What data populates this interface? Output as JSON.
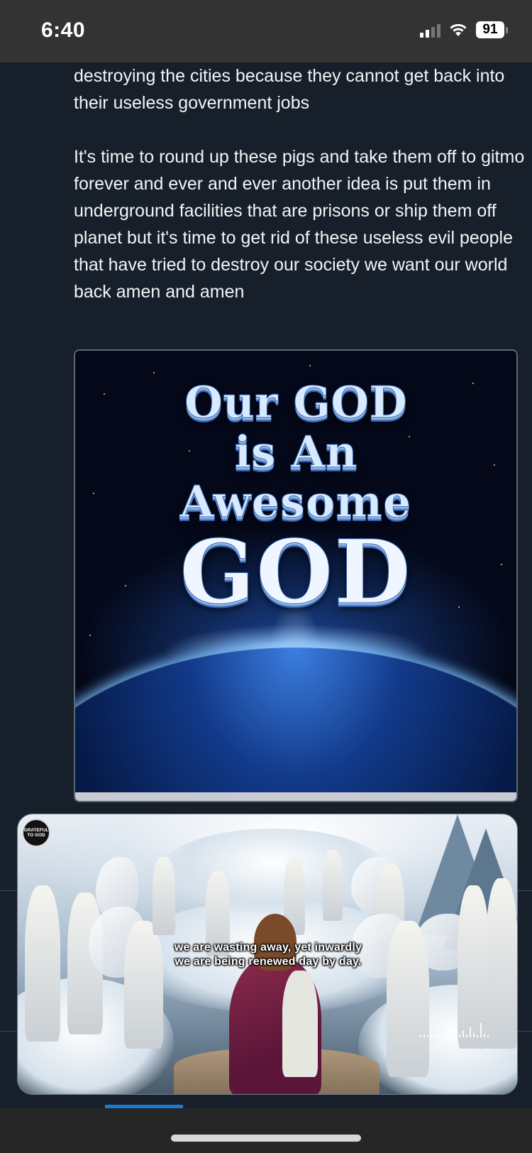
{
  "status_bar": {
    "time": "6:40",
    "battery": "91",
    "icons": [
      "cellular-signal-icon",
      "wifi-icon",
      "battery-icon"
    ]
  },
  "post": {
    "paragraphs": [
      "destroying the cities because they cannot get back into their useless government jobs",
      "It's time to round up these pigs and take them off to gitmo forever and ever and ever another idea is put them in underground facilities that are prisons or ship them off planet but it's time to get rid of these useless evil people that have tried to destroy our society we want our world back amen and amen"
    ]
  },
  "image_post": {
    "line1": "Our GOD",
    "line2": "is An",
    "line3": "Awesome",
    "line4": "GOD"
  },
  "video": {
    "channel_logo_line1": "GRATEFUL",
    "channel_logo_line2": "TO GOD",
    "caption_line1": "we are wasting away, yet inwardly",
    "caption_line2": "we are being renewed day by day."
  },
  "colors": {
    "background": "#17202a",
    "status_bar": "#333333",
    "accent": "#1a7bd6",
    "text": "#f2f4f6"
  }
}
